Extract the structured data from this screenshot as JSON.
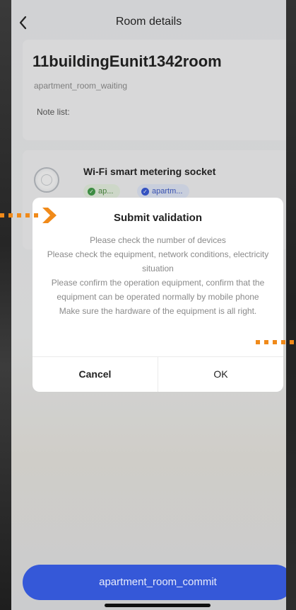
{
  "header": {
    "back_icon": "chevron-left-icon",
    "title": "Room details"
  },
  "room": {
    "name": "11buildingEunit1342room",
    "status": "apartment_room_waiting",
    "note_label": "Note list:"
  },
  "device": {
    "icon": "socket-icon",
    "name": "Wi-Fi smart metering socket",
    "tags": [
      {
        "label": "ap...",
        "icon": "check-circle-icon",
        "color": "#3f9a46"
      },
      {
        "label": "apartm...",
        "icon": "check-circle-icon",
        "color": "#3557d6"
      }
    ]
  },
  "dialog": {
    "title": "Submit validation",
    "lines": [
      "Please check the number of devices",
      "Please check the equipment, network conditions, electricity situation",
      "Please confirm the operation equipment, confirm that the equipment can be operated normally by mobile phone",
      "Make sure the hardware of the equipment is all right."
    ],
    "cancel_label": "Cancel",
    "ok_label": "OK"
  },
  "footer": {
    "commit_label": "apartment_room_commit"
  },
  "colors": {
    "accent": "#3558d8",
    "pointer": "#f08a1a"
  }
}
